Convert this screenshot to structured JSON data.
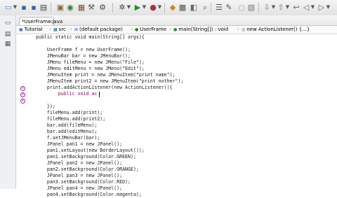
{
  "toolbar": {
    "icons": [
      "new-file-icon",
      "save-icon",
      "save-all-icon",
      "print-icon",
      "debug-icon",
      "run-icon",
      "stop-icon",
      "open-type-icon",
      "search-icon",
      "back-icon",
      "forward-icon"
    ]
  },
  "tab": {
    "label": "*UserFrame.java",
    "close": "×"
  },
  "breadcrumb": {
    "items": [
      "Tutorial",
      "src",
      "(default package)",
      "UserFrame",
      "main(String[]) : void",
      "new ActionListener() {...}"
    ],
    "sep": "›"
  },
  "code": {
    "lines": [
      "public static void main(String[] args){",
      "",
      "    UserFrame f = new UserFrame();",
      "    JMenuBar bar = new JMenuBar();",
      "    JMenu fileMenu = new JMenu(\"File\");",
      "    JMenu editMenu = new JMenu(\"Edit\");",
      "    JMenuItem print = new JMenuItem(\"print name\");",
      "    JMenuItem print2 = new JMenuItem(\"print nother\");",
      "    print.addActionListener(new ActionListener(){",
      "        public void ac",
      "",
      "    });",
      "    fileMenu.add(print);",
      "    fileMenu.add(print2);",
      "    bar.add(fileMenu);",
      "    bar.add(editMenu);",
      "    f.setJMenuBar(bar);",
      "    JPanel pan1 = new JPanel();",
      "    pan1.setLayout(new BorderLayout());",
      "    pan1.setBackground(Color.GREEN);",
      "    JPanel pan2 = new JPanel();",
      "    pan2.setBackground(Color.ORANGE);",
      "    JPanel pan3 = new JPanel();",
      "    pan3.setBackground(Color.RED);",
      "    JPanel pan4 = new JPanel();",
      "    pan4.setBackground(Color.magenta);"
    ]
  }
}
